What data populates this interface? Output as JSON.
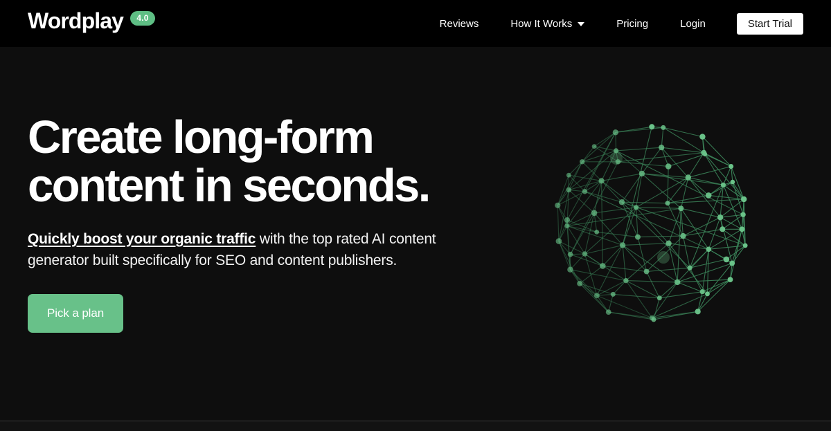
{
  "header": {
    "brand": {
      "name": "Wordplay",
      "badge": "4.0"
    },
    "nav_items": [
      {
        "label": "Reviews",
        "has_caret": false
      },
      {
        "label": "How It Works",
        "has_caret": true
      },
      {
        "label": "Pricing",
        "has_caret": false
      },
      {
        "label": "Login",
        "has_caret": false
      }
    ],
    "cta_label": "Start Trial"
  },
  "hero": {
    "headline": "Create long-form\ncontent in seconds.",
    "subhead_link": "Quickly boost your organic traffic",
    "subhead_rest": " with the top rated AI content generator built specifically for SEO and content publishers.",
    "cta_label": "Pick a plan"
  },
  "illustration": {
    "name": "network-sphere-graph",
    "node_color": "#6BC48A",
    "edge_color": "#3E8C5E"
  },
  "colors": {
    "background": "#000000",
    "hero_background": "#0e0e0e",
    "accent_green": "#68C189",
    "badge_green": "#5EBE84",
    "text_primary": "#ffffff"
  }
}
